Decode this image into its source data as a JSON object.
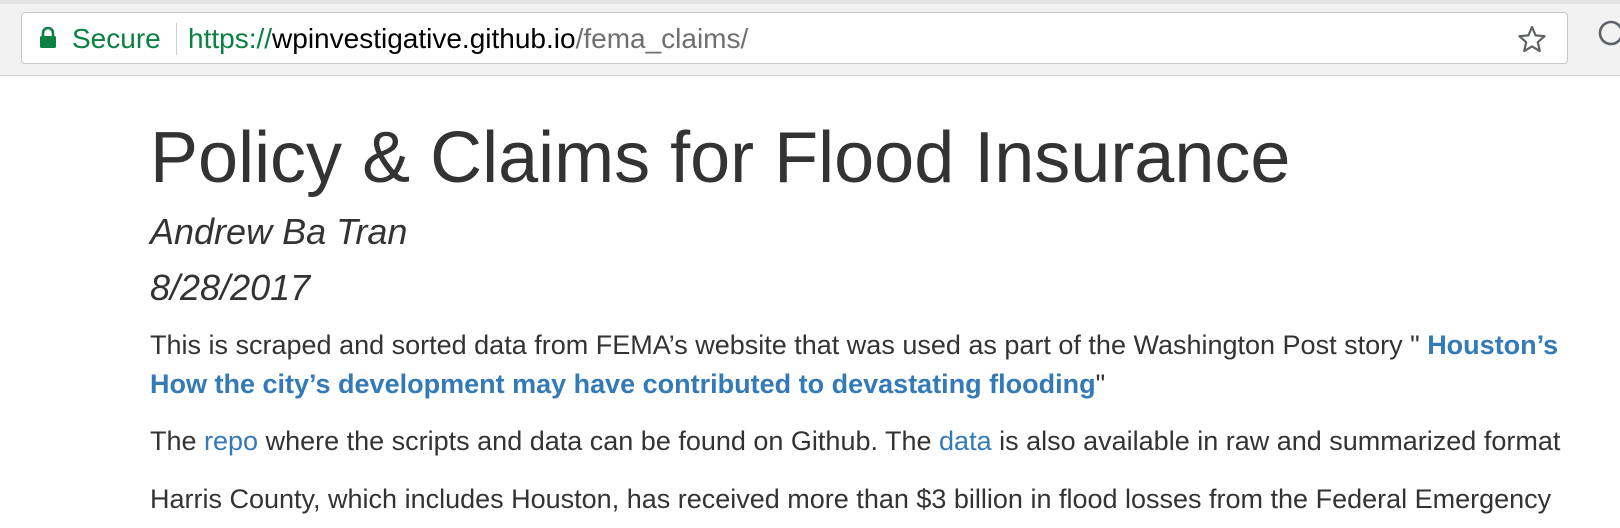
{
  "browser": {
    "secure_label": "Secure",
    "url_scheme": "https://",
    "url_host": "wpinvestigative.github.io",
    "url_path": "/fema_claims/",
    "colors": {
      "secure_green": "#0b8043",
      "link_blue": "#337ab7",
      "text": "#333333"
    }
  },
  "page": {
    "title": "Policy & Claims for Flood Insurance",
    "author": "Andrew Ba Tran",
    "date": "8/28/2017",
    "intro": {
      "text_before": "This is scraped and sorted data from FEMA’s website that was used as part of the Washington Post story \" ",
      "story_link_line1": "Houston’s",
      "story_link_line2": "How the city’s development may have contributed to devastating flooding",
      "text_after": "\""
    },
    "repo_paragraph": {
      "text_1": "The ",
      "repo_link": "repo",
      "text_2": " where the scripts and data can be found on Github. The ",
      "data_link": "data",
      "text_3": " is also available in raw and summarized format"
    },
    "harris_paragraph": {
      "text": "Harris County, which includes Houston, has received more than $3 billion in flood losses from the Federal Emergency"
    }
  }
}
